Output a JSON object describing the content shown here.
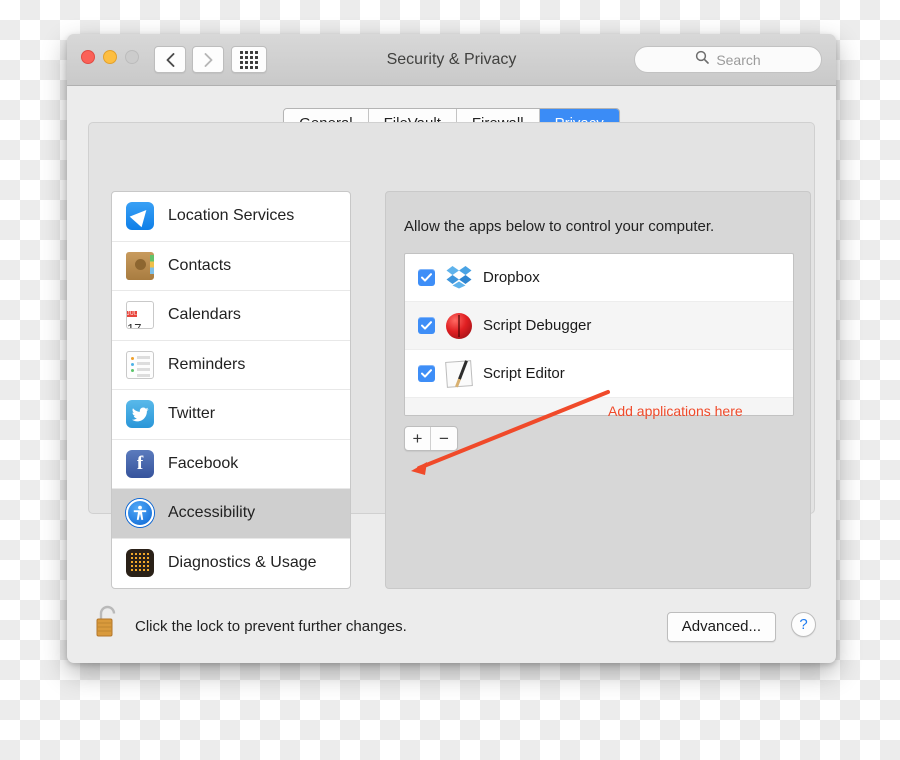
{
  "window": {
    "title": "Security & Privacy",
    "traffic_lights": [
      "close-button",
      "minimize-button",
      "zoom-button"
    ],
    "back_icon": "chevron-left-icon",
    "forward_icon": "chevron-right-icon",
    "grid_icon": "show-all-grid-icon"
  },
  "search": {
    "placeholder": "Search",
    "value": "",
    "icon": "search-icon"
  },
  "tabs": [
    {
      "label": "General",
      "active": false
    },
    {
      "label": "FileVault",
      "active": false
    },
    {
      "label": "Firewall",
      "active": false
    },
    {
      "label": "Privacy",
      "active": true
    }
  ],
  "sidebar": {
    "items": [
      {
        "label": "Location Services",
        "icon": "location-services-icon",
        "selected": false
      },
      {
        "label": "Contacts",
        "icon": "contacts-icon",
        "selected": false
      },
      {
        "label": "Calendars",
        "icon": "calendars-icon",
        "selected": false,
        "calendar_month": "JUL",
        "calendar_day": "17"
      },
      {
        "label": "Reminders",
        "icon": "reminders-icon",
        "selected": false
      },
      {
        "label": "Twitter",
        "icon": "twitter-icon",
        "selected": false
      },
      {
        "label": "Facebook",
        "icon": "facebook-icon",
        "selected": false
      },
      {
        "label": "Accessibility",
        "icon": "accessibility-icon",
        "selected": true
      },
      {
        "label": "Diagnostics & Usage",
        "icon": "diagnostics-icon",
        "selected": false
      }
    ]
  },
  "main": {
    "allow_text": "Allow the apps below to control your computer.",
    "apps": [
      {
        "label": "Dropbox",
        "icon": "dropbox-icon",
        "checked": true
      },
      {
        "label": "Script Debugger",
        "icon": "script-debugger-icon",
        "checked": true
      },
      {
        "label": "Script Editor",
        "icon": "script-editor-icon",
        "checked": true
      }
    ],
    "add_label": "+",
    "remove_label": "−"
  },
  "annotation": {
    "text": "Add applications here",
    "color": "#f04a2a"
  },
  "footer": {
    "lock_icon": "unlocked-padlock-icon",
    "lock_hint": "Click the lock to prevent further changes.",
    "advanced_label": "Advanced...",
    "help_label": "?"
  },
  "colors": {
    "accent_blue": "#3b8cf6",
    "checkbox_blue": "#3e8ef7",
    "annotation_red": "#f04a2a",
    "selected_row_gray": "#cfcfcf"
  }
}
